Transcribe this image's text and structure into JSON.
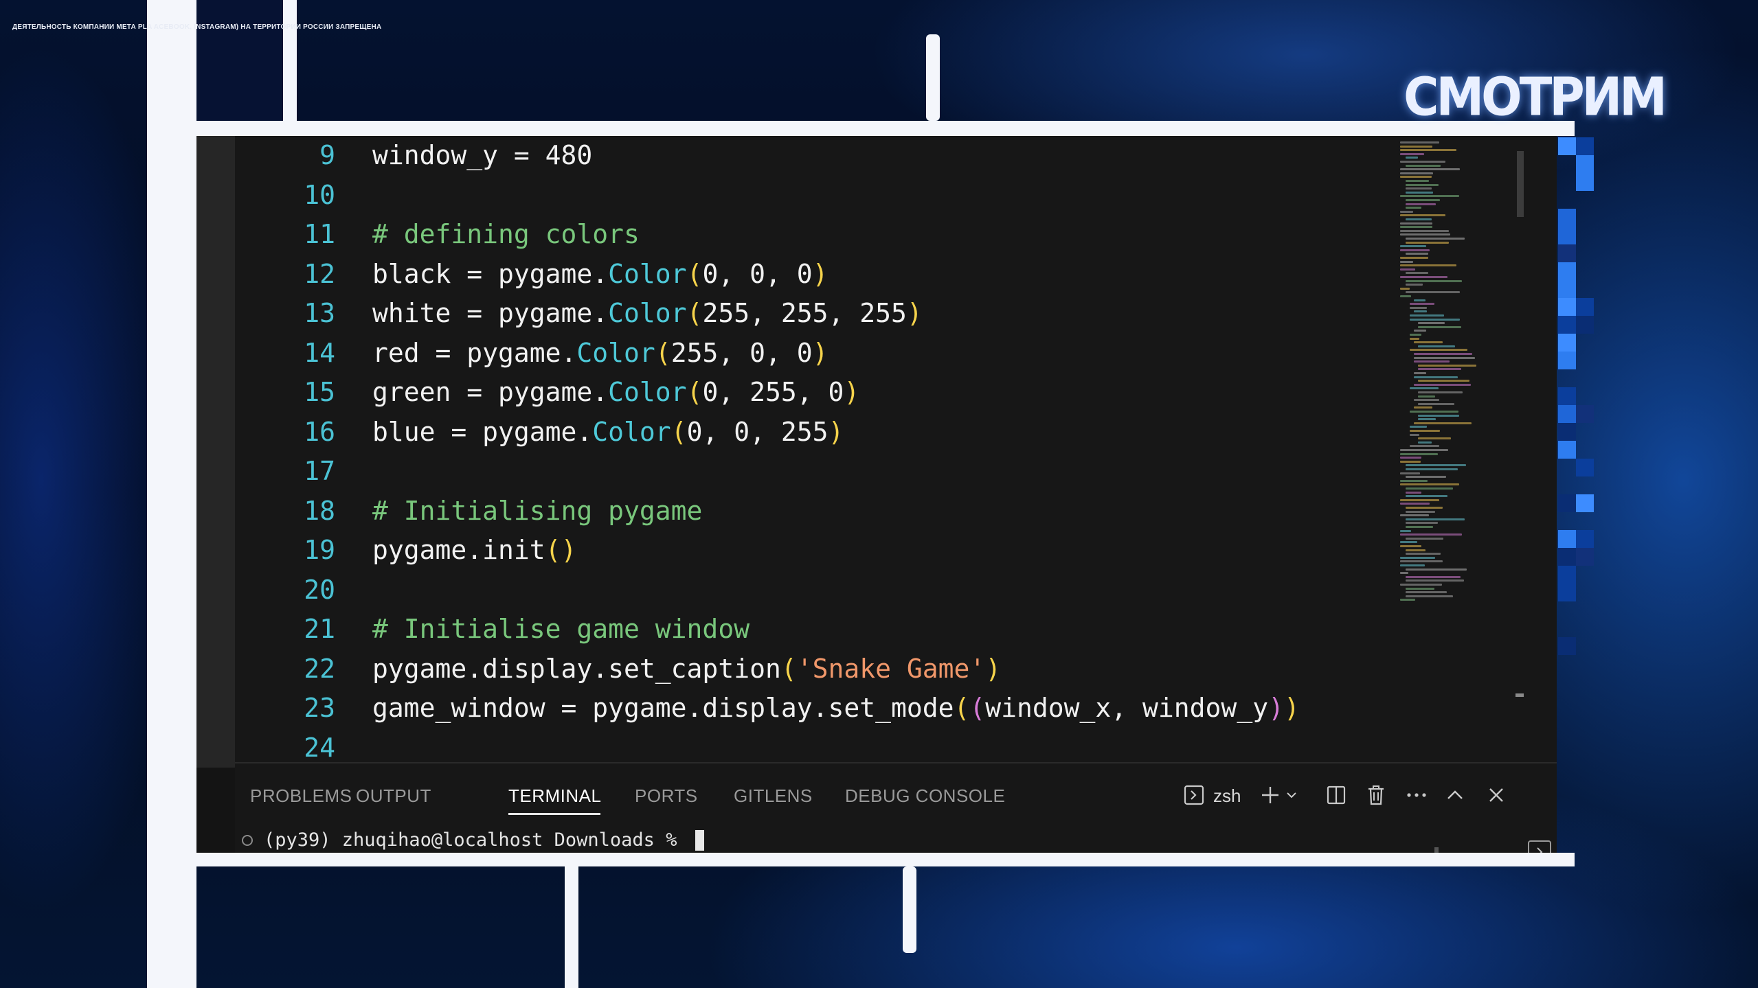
{
  "overlay": {
    "ticker_text": "ДЕЯТЕЛЬНОСТЬ КОМПАНИИ МЕТА PLA          ACEBOOK, INSTAGRAM) НА ТЕРРИТОРИИ РОССИИ ЗАПРЕЩЕНА",
    "channel_logo": "СМОТРИМ"
  },
  "editor": {
    "lines": [
      {
        "num": "9",
        "tokens": [
          {
            "t": "window_y = 480",
            "c": ""
          }
        ]
      },
      {
        "num": "10",
        "tokens": []
      },
      {
        "num": "11",
        "tokens": [
          {
            "t": "# defining colors",
            "c": "comment"
          }
        ]
      },
      {
        "num": "12",
        "tokens": [
          {
            "t": "black = pygame.",
            "c": ""
          },
          {
            "t": "Color",
            "c": "class"
          },
          {
            "t": "(",
            "c": "paren"
          },
          {
            "t": "0, 0, 0",
            "c": ""
          },
          {
            "t": ")",
            "c": "paren"
          }
        ]
      },
      {
        "num": "13",
        "tokens": [
          {
            "t": "white = pygame.",
            "c": ""
          },
          {
            "t": "Color",
            "c": "class"
          },
          {
            "t": "(",
            "c": "paren"
          },
          {
            "t": "255, 255, 255",
            "c": ""
          },
          {
            "t": ")",
            "c": "paren"
          }
        ]
      },
      {
        "num": "14",
        "tokens": [
          {
            "t": "red = pygame.",
            "c": ""
          },
          {
            "t": "Color",
            "c": "class"
          },
          {
            "t": "(",
            "c": "paren"
          },
          {
            "t": "255, 0, 0",
            "c": ""
          },
          {
            "t": ")",
            "c": "paren"
          }
        ]
      },
      {
        "num": "15",
        "tokens": [
          {
            "t": "green = pygame.",
            "c": ""
          },
          {
            "t": "Color",
            "c": "class"
          },
          {
            "t": "(",
            "c": "paren"
          },
          {
            "t": "0, 255, 0",
            "c": ""
          },
          {
            "t": ")",
            "c": "paren"
          }
        ]
      },
      {
        "num": "16",
        "tokens": [
          {
            "t": "blue = pygame.",
            "c": ""
          },
          {
            "t": "Color",
            "c": "class"
          },
          {
            "t": "(",
            "c": "paren"
          },
          {
            "t": "0, 0, 255",
            "c": ""
          },
          {
            "t": ")",
            "c": "paren"
          }
        ]
      },
      {
        "num": "17",
        "tokens": []
      },
      {
        "num": "18",
        "tokens": [
          {
            "t": "# Initialising pygame",
            "c": "comment"
          }
        ]
      },
      {
        "num": "19",
        "tokens": [
          {
            "t": "pygame.init",
            "c": ""
          },
          {
            "t": "()",
            "c": "paren"
          }
        ]
      },
      {
        "num": "20",
        "tokens": []
      },
      {
        "num": "21",
        "tokens": [
          {
            "t": "# Initialise game window",
            "c": "comment"
          }
        ]
      },
      {
        "num": "22",
        "tokens": [
          {
            "t": "pygame.display.set_caption",
            "c": ""
          },
          {
            "t": "(",
            "c": "paren"
          },
          {
            "t": "'Snake Game'",
            "c": "string"
          },
          {
            "t": ")",
            "c": "paren"
          }
        ]
      },
      {
        "num": "23",
        "tokens": [
          {
            "t": "game_window = pygame.display.set_mode",
            "c": ""
          },
          {
            "t": "(",
            "c": "paren"
          },
          {
            "t": "(",
            "c": "paren2"
          },
          {
            "t": "window_x, window_y",
            "c": ""
          },
          {
            "t": ")",
            "c": "paren2"
          },
          {
            "t": ")",
            "c": "paren"
          }
        ]
      },
      {
        "num": "24",
        "tokens": []
      }
    ]
  },
  "panel": {
    "tabs": [
      "PROBLEMS",
      "OUTPUT",
      "TERMINAL",
      "PORTS",
      "GITLENS",
      "DEBUG CONSOLE"
    ],
    "active_tab": "TERMINAL",
    "shell": "zsh",
    "terminal_prompt": "(py39) zhuqihao@localhost Downloads % ",
    "icons": [
      "terminal-icon",
      "add-terminal-icon",
      "chevron-down-icon",
      "split-icon",
      "trash-icon",
      "more-icon",
      "chevron-up-icon",
      "close-icon"
    ]
  },
  "colors": {
    "line_number": "#4bc2d4",
    "comment": "#79c77c",
    "class": "#4ec9d8",
    "paren": "#f6d34b",
    "string": "#f0976a",
    "background": "#171717"
  }
}
